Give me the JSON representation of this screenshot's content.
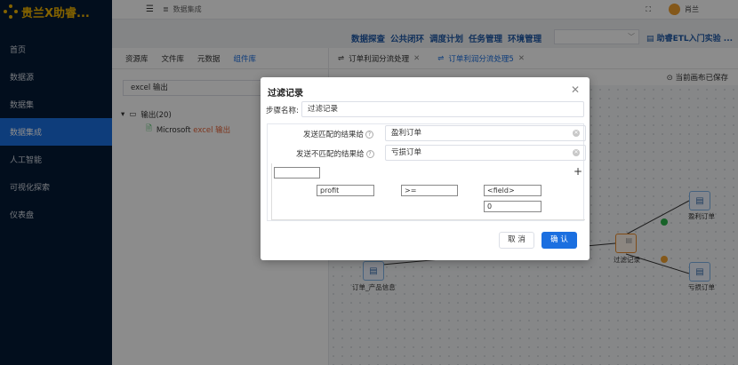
{
  "app": {
    "title": "贵兰X助睿..."
  },
  "sidebar": {
    "items": [
      {
        "label": "首页"
      },
      {
        "label": "数据源"
      },
      {
        "label": "数据集"
      },
      {
        "label": "数据集成",
        "active": true
      },
      {
        "label": "人工智能"
      },
      {
        "label": "可视化探索"
      },
      {
        "label": "仪表盘"
      }
    ]
  },
  "header": {
    "breadcrumb": "数据集成",
    "user": "肖兰",
    "fullscreen_icon": "fullscreen-icon"
  },
  "topnav": {
    "items": [
      "数据探查",
      "公共闭环",
      "调度计划",
      "任务管理",
      "环境管理"
    ],
    "select_value": "",
    "guide": "助睿ETL入门实验 ..."
  },
  "left_panel": {
    "tabs": [
      "资源库",
      "文件库",
      "元数据",
      "组件库"
    ],
    "active_tab": 3,
    "search_value": "excel 输出",
    "tree": {
      "folder": "输出(20)",
      "item_prefix": "Microsoft ",
      "item_highlight": "excel 输出"
    }
  },
  "canvas": {
    "tabs": [
      {
        "label": "订单利润分流处理"
      },
      {
        "label": "订单利润分流处理5",
        "active": true
      }
    ],
    "saved_text": "当前画布已保存",
    "nodes": {
      "filter": "过滤记录",
      "profit": "盈利订单",
      "loss": "亏损订单",
      "product": "订单_产品信息"
    }
  },
  "dialog": {
    "title": "过滤记录",
    "step_name_label": "步骤名称:",
    "step_name_value": "过滤记录",
    "match_label": "发送匹配的结果给",
    "match_value": "盈利订单",
    "nomatch_label": "发送不匹配的结果给",
    "nomatch_value": "亏损订单",
    "condition": {
      "top_value": "",
      "field": "profit",
      "operator": ">=",
      "value_field": "<field>",
      "value": "0"
    },
    "cancel_label": "取 消",
    "ok_label": "确 认"
  },
  "colors": {
    "sidebar_bg": "#051a35",
    "accent": "#1b6fe0",
    "logo": "#f0b400",
    "success": "#2bb34a",
    "warning": "#f0a030"
  }
}
